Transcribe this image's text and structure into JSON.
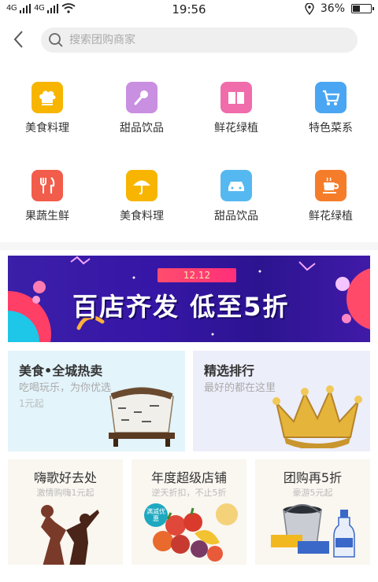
{
  "status_bar": {
    "signal_left": "4G",
    "signal_right": "4G",
    "time": "19:56",
    "battery": "36%",
    "battery_level": 0.36
  },
  "search": {
    "placeholder": "搜索团购商家"
  },
  "categories": [
    {
      "label": "美食料理",
      "icon": "chef-hat-icon",
      "color": "#f7b500"
    },
    {
      "label": "甜品饮品",
      "icon": "microphone-icon",
      "color": "#c98fe0"
    },
    {
      "label": "鲜花绿植",
      "icon": "book-icon",
      "color": "#f06cab"
    },
    {
      "label": "特色菜系",
      "icon": "cart-icon",
      "color": "#4aa6f2"
    },
    {
      "label": "果蔬生鲜",
      "icon": "utensils-icon",
      "color": "#f25c4a"
    },
    {
      "label": "美食料理",
      "icon": "umbrella-icon",
      "color": "#f7b500"
    },
    {
      "label": "甜品饮品",
      "icon": "car-icon",
      "color": "#56b8f0"
    },
    {
      "label": "鲜花绿植",
      "icon": "coffee-icon",
      "color": "#f57d2a"
    }
  ],
  "banner": {
    "tag": "12.12",
    "headline": "百店齐发 低至5折"
  },
  "promo_large": [
    {
      "title": "美食•全城热卖",
      "subtitle": "吃喝玩乐，为你优选",
      "price": "1元起",
      "bg": "#e3f4fb"
    },
    {
      "title": "精选排行",
      "subtitle": "最好的都在这里",
      "price": "",
      "bg": "#eceefa"
    }
  ],
  "promo_small": [
    {
      "title": "嗨歌好去处",
      "subtitle": "激情购嗨1元起"
    },
    {
      "title": "年度超级店铺",
      "subtitle": "逆天折扣，不止5折",
      "badge": "满减优惠"
    },
    {
      "title": "团购再5折",
      "subtitle": "豪游5元起"
    }
  ]
}
